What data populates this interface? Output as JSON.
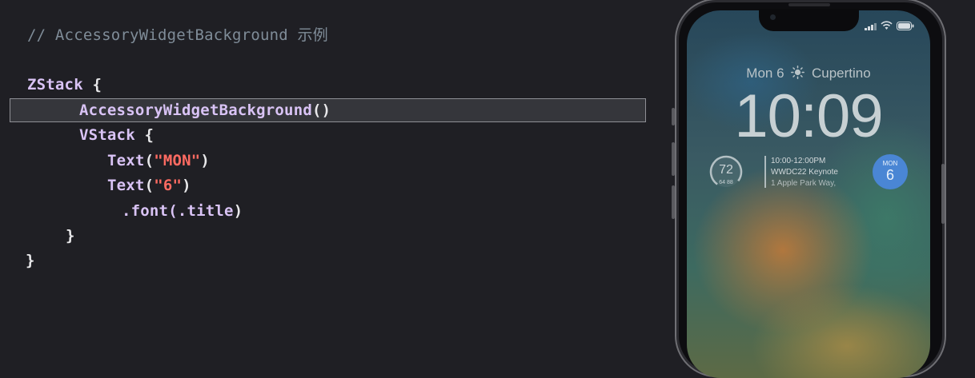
{
  "code": {
    "comment": "// AccessoryWidgetBackground 示例",
    "zstack": "ZStack",
    "brace_open": " {",
    "accessory": "AccessoryWidgetBackground",
    "parens": "()",
    "vstack": "VStack",
    "text_kw": "Text",
    "paren_open": "(",
    "paren_close": ")",
    "str_mon": "\"MON\"",
    "str_6": "\"6\"",
    "dot_font": ".font",
    "dot_title": "(.title",
    "brace_close": "}"
  },
  "phone": {
    "date_label": "Mon 6",
    "city": "Cupertino",
    "time": "10:09",
    "weather": {
      "temp": "72",
      "range": "64  88"
    },
    "event": {
      "time": "10:00-12:00PM",
      "title": "WWDC22 Keynote",
      "location": "1 Apple Park Way,"
    },
    "date_widget": {
      "month": "MON",
      "day": "6"
    },
    "icons": [
      "sun-icon",
      "signal-icon",
      "wifi-icon",
      "battery-icon"
    ]
  }
}
